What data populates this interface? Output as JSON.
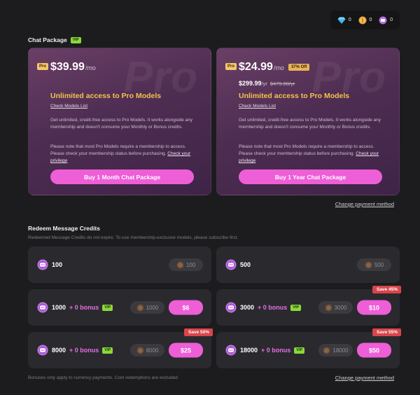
{
  "wallet": {
    "diamonds": "0",
    "gold": "0",
    "credits": "0"
  },
  "chat_package": {
    "title": "Chat Package",
    "vip": "VIP",
    "plans": [
      {
        "badge": "Pro",
        "watermark": "Pro",
        "price": "$39.99",
        "period": "/mo",
        "headline": "Unlimited access to Pro Models",
        "link": "Check Models List",
        "desc": "Get unlimited, credit-free access to Pro Models. It works alongside any membership and doesn't consume your Monthly or Bonus credits.",
        "note": "Please note that most Pro Models require a membership to access. Please check your membership status before purchasing.",
        "note_link": "Check your privilege",
        "button": "Buy 1 Month Chat Package"
      },
      {
        "badge": "Pro",
        "watermark": "Pro",
        "price": "$24.99",
        "period": "/mo",
        "discount": "37% Off",
        "yearly_price": "$299.99",
        "yearly_period": "/yr",
        "original_price": "$479.88/yr",
        "headline": "Unlimited access to Pro Models",
        "link": "Check Models List",
        "desc": "Get unlimited, credit-free access to Pro Models. It works alongside any membership and doesn't consume your Monthly or Bonus credits.",
        "note": "Please note that most Pro Models require a membership to access. Please check your membership status before purchasing.",
        "note_link": "Check your privilege",
        "button": "Buy 1 Year Chat Package"
      }
    ],
    "change_payment": "Change payment method"
  },
  "redeem": {
    "title": "Redeem Message Credits",
    "subtitle": "Redeemed Message Credits do not expire. To use membership-exclusive models, please subscribe first.",
    "packs": [
      {
        "amount": "100",
        "coin_cost": "100"
      },
      {
        "amount": "500",
        "coin_cost": "500"
      },
      {
        "amount": "1000",
        "bonus": "+ 0 bonus",
        "vip": "VIP",
        "coin_cost": "1000",
        "price": "$6"
      },
      {
        "amount": "3000",
        "bonus": "+ 0 bonus",
        "vip": "VIP",
        "coin_cost": "3000",
        "price": "$10",
        "save": "Save 45%"
      },
      {
        "amount": "8000",
        "bonus": "+ 0 bonus",
        "vip": "VIP",
        "coin_cost": "8000",
        "price": "$25",
        "save": "Save 50%"
      },
      {
        "amount": "18000",
        "bonus": "+ 0 bonus",
        "vip": "VIP",
        "coin_cost": "18000",
        "price": "$50",
        "save": "Save 55%"
      }
    ],
    "footnote": "Bonuses only apply to currency payments. Coin redemptions are excluded",
    "change_payment": "Change payment method"
  },
  "colors": {
    "accent": "#ee5ed7",
    "gold": "#f5c24b",
    "vip": "#8ad83b",
    "save": "#d9454b"
  }
}
